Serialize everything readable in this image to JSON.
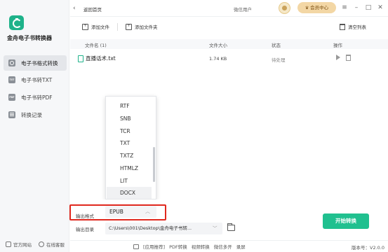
{
  "app": {
    "name": "金舟电子书转换器"
  },
  "sidebar": {
    "items": [
      {
        "label": "电子书格式转换",
        "icon": "convert-icon",
        "active": true
      },
      {
        "label": "电子书转TXT",
        "icon": "txt-icon",
        "badge": "TXT"
      },
      {
        "label": "电子书转PDF",
        "icon": "pdf-icon",
        "badge": "PDF"
      },
      {
        "label": "转换记录",
        "icon": "record-icon"
      }
    ],
    "footer": {
      "website": "官方网站",
      "service": "在线客服"
    }
  },
  "titlebar": {
    "back_label": "返回首页",
    "user_label": "微信用户",
    "vip_label": "会员中心",
    "controls": [
      "≡",
      "–",
      "□",
      "✕"
    ]
  },
  "toolbar": {
    "add_file": "添加文件",
    "add_folder": "添加文件夹",
    "clear_list": "清空列表"
  },
  "table": {
    "columns": [
      "文件名 (1)",
      "文件大小",
      "状态",
      "操作"
    ],
    "rows": [
      {
        "name": "直播话术.txt",
        "size": "1.74 KB",
        "status": "待处理"
      }
    ]
  },
  "dropdown": {
    "options": [
      "RTF",
      "SNB",
      "TCR",
      "TXT",
      "TXTZ",
      "HTMLZ",
      "LIT",
      "DOCX"
    ],
    "selected": "DOCX"
  },
  "output": {
    "format_label": "输出格式",
    "format_value": "EPUB",
    "dir_label": "输出目录",
    "dir_value": "C:\\Users\\001\\Desktop\\金舟电子书转...",
    "start_label": "开始转换"
  },
  "statusbar": {
    "links": [
      "[应用推荐]",
      "PDF转换",
      "视频转换",
      "微信多开",
      "录屏"
    ],
    "version": "版本号：V2.0.0"
  },
  "colors": {
    "accent": "#20c08f",
    "highlight": "#e0281e",
    "vip": "#f3d7a5"
  }
}
